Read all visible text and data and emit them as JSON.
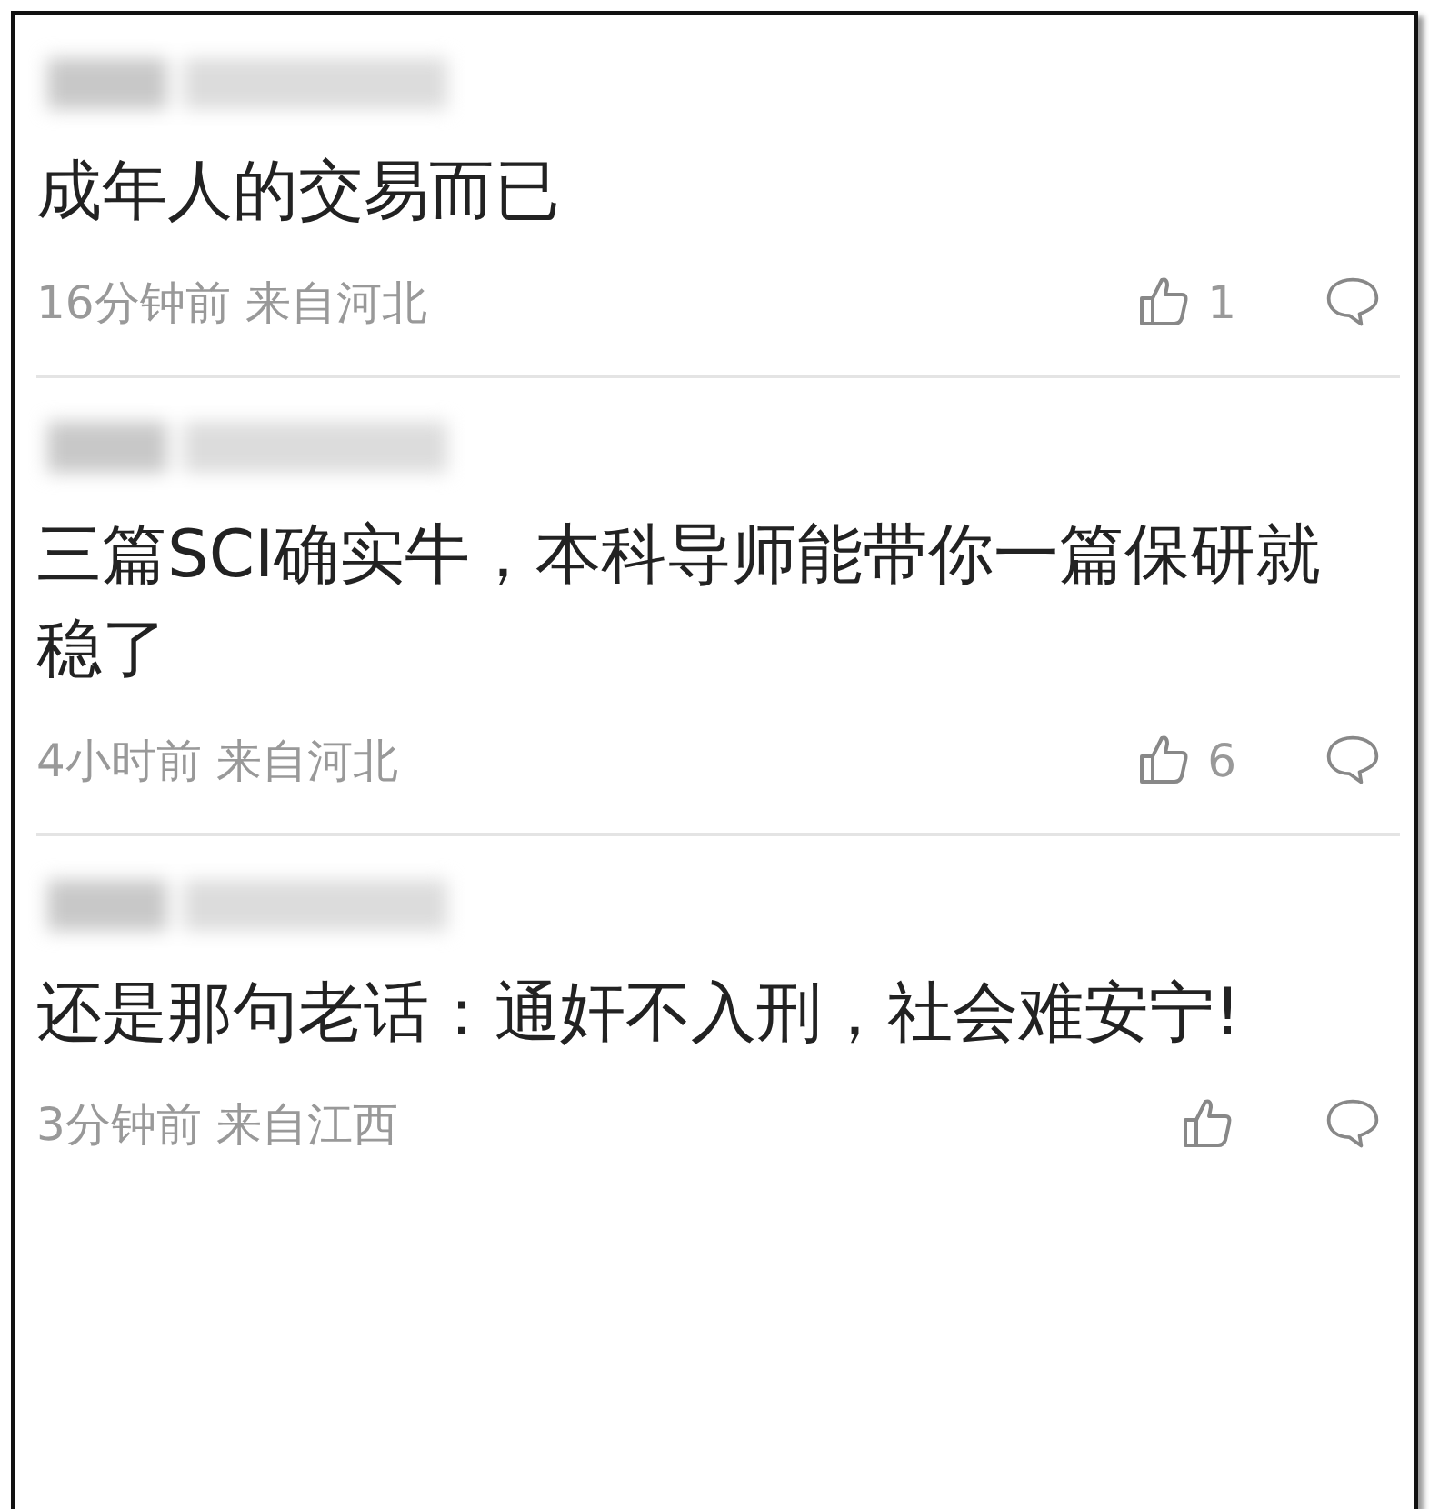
{
  "comments": [
    {
      "text": "成年人的交易而已",
      "time": "16分钟前",
      "location": "来自河北",
      "likes": "1"
    },
    {
      "text": "三篇SCI确实牛，本科导师能带你一篇保研就稳了",
      "time": "4小时前",
      "location": "来自河北",
      "likes": "6"
    },
    {
      "text": "还是那句老话：通奸不入刑，社会难安宁!",
      "time": "3分钟前",
      "location": "来自江西"
    }
  ]
}
